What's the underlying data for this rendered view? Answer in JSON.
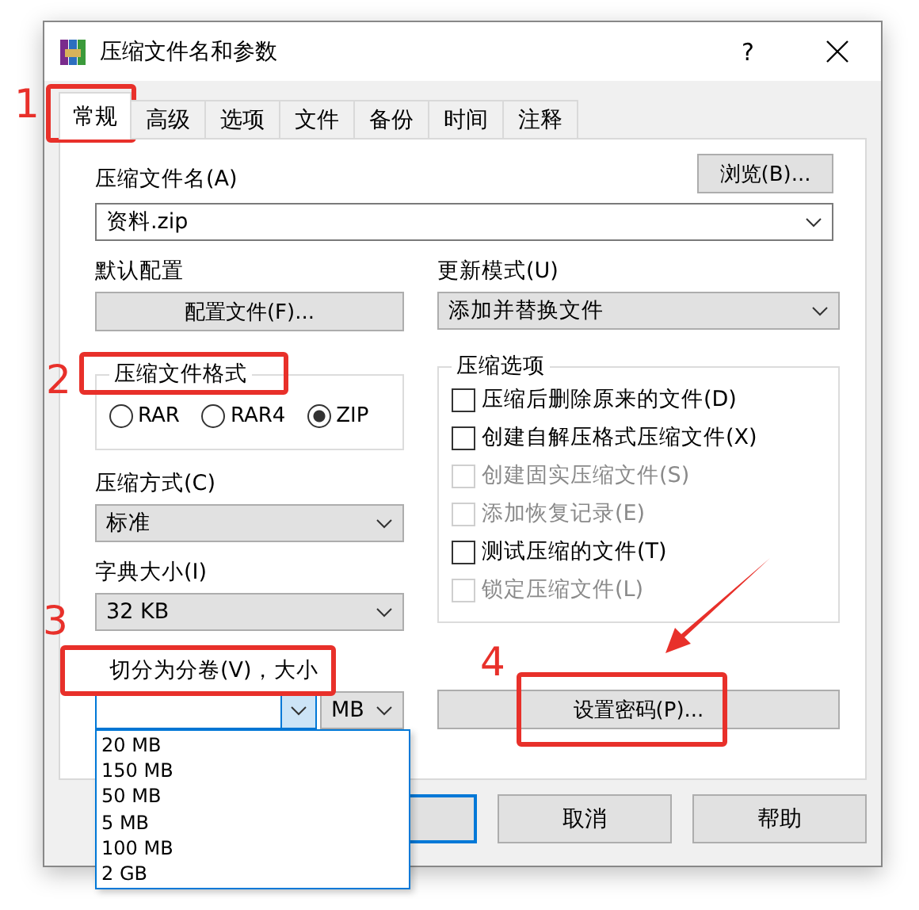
{
  "window": {
    "title": "压缩文件名和参数",
    "help_button": "?"
  },
  "tabs": [
    {
      "label": "常规",
      "selected": true
    },
    {
      "label": "高级",
      "selected": false
    },
    {
      "label": "选项",
      "selected": false
    },
    {
      "label": "文件",
      "selected": false
    },
    {
      "label": "备份",
      "selected": false
    },
    {
      "label": "时间",
      "selected": false
    },
    {
      "label": "注释",
      "selected": false
    }
  ],
  "archive_name": {
    "label": "压缩文件名(A)",
    "value": "资料.zip",
    "browse_button": "浏览(B)..."
  },
  "profile": {
    "label": "默认配置",
    "button": "配置文件(F)..."
  },
  "update_mode": {
    "label": "更新模式(U)",
    "value": "添加并替换文件"
  },
  "archive_format": {
    "label": "压缩文件格式",
    "options": [
      {
        "label": "RAR",
        "selected": false
      },
      {
        "label": "RAR4",
        "selected": false
      },
      {
        "label": "ZIP",
        "selected": true
      }
    ]
  },
  "compression_method": {
    "label": "压缩方式(C)",
    "value": "标准"
  },
  "dictionary_size": {
    "label": "字典大小(I)",
    "value": "32 KB"
  },
  "split_volumes": {
    "label": "切分为分卷(V)，大小",
    "unit": "MB",
    "dropdown_open": true,
    "dropdown_items": [
      "20 MB",
      "150 MB",
      "50 MB",
      "5 MB",
      "100 MB",
      "2 GB"
    ]
  },
  "archive_options": {
    "label": "压缩选项",
    "items": [
      {
        "label": "压缩后删除原来的文件(D)",
        "checked": false,
        "disabled": false
      },
      {
        "label": "创建自解压格式压缩文件(X)",
        "checked": false,
        "disabled": false
      },
      {
        "label": "创建固实压缩文件(S)",
        "checked": false,
        "disabled": true
      },
      {
        "label": "添加恢复记录(E)",
        "checked": false,
        "disabled": true
      },
      {
        "label": "测试压缩的文件(T)",
        "checked": false,
        "disabled": false
      },
      {
        "label": "锁定压缩文件(L)",
        "checked": false,
        "disabled": true
      }
    ]
  },
  "password_button": "设置密码(P)...",
  "buttons": [
    {
      "default": true
    },
    {
      "label": "取消",
      "default": false
    },
    {
      "label": "帮助",
      "default": false
    }
  ],
  "annotations": [
    {
      "number": "1"
    },
    {
      "number": "2"
    },
    {
      "number": "3"
    },
    {
      "number": "4"
    }
  ]
}
